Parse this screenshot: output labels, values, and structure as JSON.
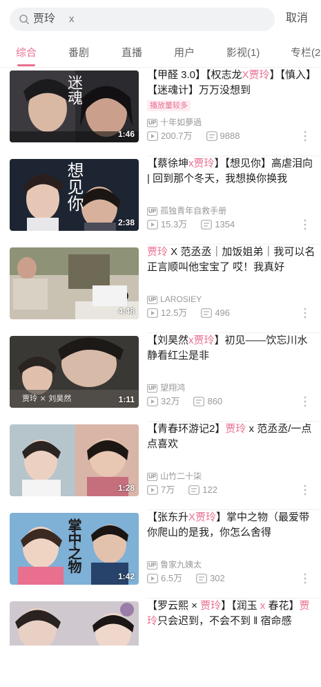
{
  "search": {
    "query": "贾玲",
    "clear": "x",
    "cancel_label": "取消"
  },
  "tabs": [
    "综合",
    "番剧",
    "直播",
    "用户",
    "影视(1)",
    "专栏(2"
  ],
  "colors": {
    "accent": "#e96f8f",
    "text": "#212121",
    "muted": "#999999"
  },
  "results": [
    {
      "title_parts": [
        [
          "【甲醛 3.0】【权志龙",
          false
        ],
        [
          "X贾玲",
          true
        ],
        [
          "】【慎入】【迷魂计】万万没想到",
          false
        ]
      ],
      "badge": "播放量较多",
      "uploader": "十年如夢過",
      "views": "200.7万",
      "danmaku": "9888",
      "duration": "1:46",
      "thumb_overlay": "迷魂"
    },
    {
      "title_parts": [
        [
          "【蔡徐坤",
          false
        ],
        [
          "x贾玲",
          true
        ],
        [
          "】【想见你】高虐泪向 | 回到那个冬天，我想换你换我",
          false
        ]
      ],
      "badge": "",
      "uploader": "孤独青年自救手册",
      "views": "15.3万",
      "danmaku": "1354",
      "duration": "2:38",
      "thumb_overlay": "想见你"
    },
    {
      "title_parts": [
        [
          "贾玲",
          true
        ],
        [
          " X 范丞丞",
          false
        ],
        [
          "｜加饭姐弟｜我可以名正言顺叫他宝宝了 哎！我真好",
          false
        ]
      ],
      "badge": "",
      "uploader": "LAROSIEY",
      "views": "12.5万",
      "danmaku": "496",
      "duration": "4:48",
      "thumb_overlay": ""
    },
    {
      "title_parts": [
        [
          "【刘昊然",
          false
        ],
        [
          "x贾玲",
          true
        ],
        [
          "】初见——饮忘川水 静看红尘是非",
          false
        ]
      ],
      "badge": "",
      "uploader": "望翔鸿",
      "views": "32万",
      "danmaku": "860",
      "duration": "1:11",
      "thumb_overlay": "贾玲 × 刘昊然"
    },
    {
      "title_parts": [
        [
          "【青春环游记2】",
          false
        ],
        [
          "贾玲",
          true
        ],
        [
          " x 范丞丞/一点点喜欢",
          false
        ]
      ],
      "badge": "",
      "uploader": "山竹二十柒",
      "views": "7万",
      "danmaku": "122",
      "duration": "1:28",
      "thumb_overlay": ""
    },
    {
      "title_parts": [
        [
          "【张东升",
          false
        ],
        [
          "X贾玲",
          true
        ],
        [
          "】掌中之物（最爱带你爬山的是我，你怎么舍得",
          false
        ]
      ],
      "badge": "",
      "uploader": "鲁家九姨太",
      "views": "6.5万",
      "danmaku": "302",
      "duration": "1:42",
      "thumb_overlay": "掌中之物"
    },
    {
      "title_parts": [
        [
          "【罗云熙 × ",
          false
        ],
        [
          "贾玲",
          true
        ],
        [
          "】【润玉",
          false
        ],
        [
          " x ",
          true
        ],
        [
          "春花】",
          false
        ],
        [
          "贾玲",
          true
        ],
        [
          "只会迟到，不会不到 ‖ 宿命感",
          false
        ]
      ],
      "badge": "",
      "uploader": "",
      "views": "",
      "danmaku": "",
      "duration": "",
      "thumb_overlay": ""
    }
  ]
}
